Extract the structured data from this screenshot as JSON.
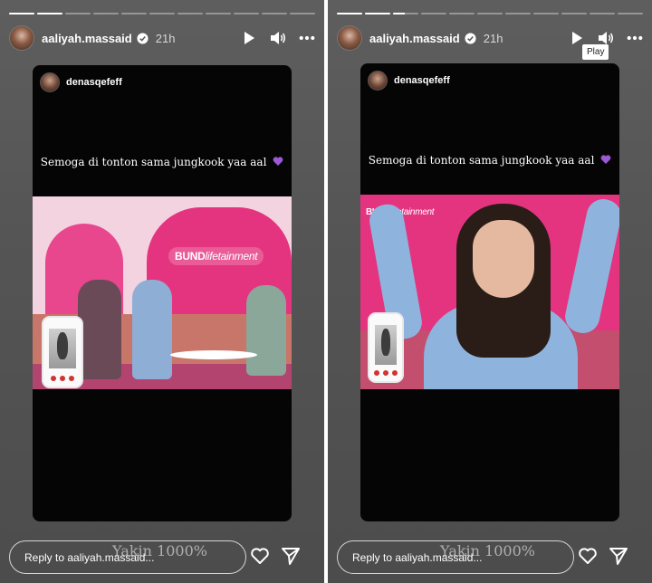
{
  "stories": [
    {
      "progress": [
        1,
        1,
        0,
        0,
        0,
        0,
        0,
        0,
        0,
        0,
        0
      ],
      "header": {
        "username": "aaliyah.massaid",
        "time": "21h"
      },
      "card": {
        "username": "denasqefeff",
        "caption": "Semoga di tonton sama jungkook yaa aal",
        "logo": {
          "bold": "BUND",
          "rest": "lifetainment"
        }
      },
      "reply_placeholder": "Reply to aaliyah.massaid...",
      "watermark": "Yakin 1000%"
    },
    {
      "progress": [
        1,
        1,
        0.45,
        0,
        0,
        0,
        0,
        0,
        0,
        0,
        0
      ],
      "header": {
        "username": "aaliyah.massaid",
        "time": "21h"
      },
      "tooltip": "Play",
      "card": {
        "username": "denasqefeff",
        "caption": "Semoga di tonton sama jungkook yaa aal",
        "logo": {
          "bold": "BUND",
          "rest": "lifetainment"
        }
      },
      "reply_placeholder": "Reply to aaliyah.massaid...",
      "watermark": "Yakin 1000%"
    }
  ],
  "colors": {
    "accent_pink": "#e4347f",
    "heart_purple": "#9b59d6",
    "panel_bg": "#555555"
  },
  "icons": [
    "play-icon",
    "volume-icon",
    "more-icon",
    "verified-icon",
    "heart-icon",
    "send-icon",
    "purple-heart-emoji"
  ]
}
